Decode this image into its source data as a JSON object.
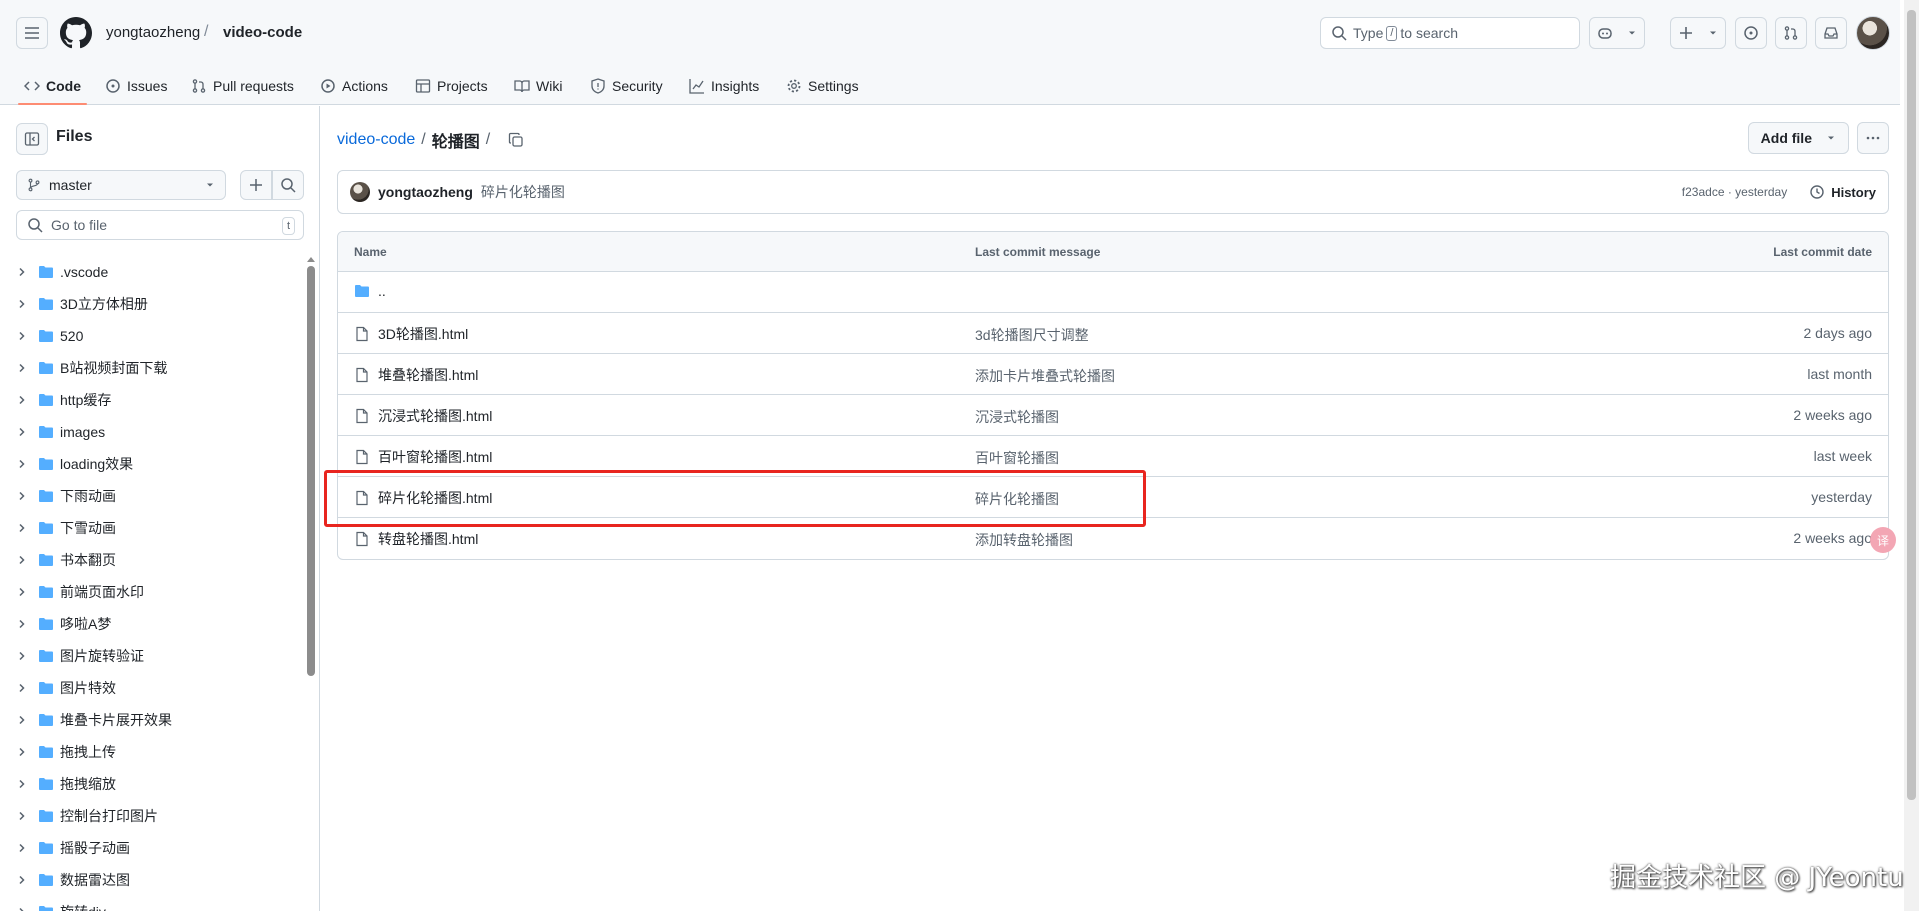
{
  "header": {
    "owner": "yongtaozheng",
    "separator": "/",
    "repo": "video-code",
    "search_prefix": "Type",
    "search_key": "/",
    "search_suffix": "to search"
  },
  "nav": [
    {
      "label": "Code",
      "icon": "code-icon",
      "active": true
    },
    {
      "label": "Issues",
      "icon": "issue-icon"
    },
    {
      "label": "Pull requests",
      "icon": "pull-request-icon"
    },
    {
      "label": "Actions",
      "icon": "play-icon"
    },
    {
      "label": "Projects",
      "icon": "table-icon"
    },
    {
      "label": "Wiki",
      "icon": "book-icon"
    },
    {
      "label": "Security",
      "icon": "shield-icon"
    },
    {
      "label": "Insights",
      "icon": "graph-icon"
    },
    {
      "label": "Settings",
      "icon": "gear-icon"
    }
  ],
  "sidebar": {
    "title": "Files",
    "branch": "master",
    "goto_placeholder": "Go to file",
    "goto_key": "t",
    "items": [
      ".vscode",
      "3D立方体相册",
      "520",
      "B站视频封面下载",
      "http缓存",
      "images",
      "loading效果",
      "下雨动画",
      "下雪动画",
      "书本翻页",
      "前端页面水印",
      "哆啦A梦",
      "图片旋转验证",
      "图片特效",
      "堆叠卡片展开效果",
      "拖拽上传",
      "拖拽缩放",
      "控制台打印图片",
      "摇骰子动画",
      "数据雷达图",
      "旋转div"
    ]
  },
  "main": {
    "path_repo": "video-code",
    "path_sep": "/",
    "path_folder": "轮播图",
    "path_trail": "/",
    "add_file": "Add file",
    "commit": {
      "author": "yongtaozheng",
      "message": "碎片化轮播图",
      "meta": "f23adce · yesterday",
      "history": "History"
    },
    "table": {
      "headers": [
        "Name",
        "Last commit message",
        "Last commit date"
      ],
      "parent": "..",
      "rows": [
        {
          "name": "3D轮播图.html",
          "msg": "3d轮播图尺寸调整",
          "date": "2 days ago"
        },
        {
          "name": "堆叠轮播图.html",
          "msg": "添加卡片堆叠式轮播图",
          "date": "last month"
        },
        {
          "name": "沉浸式轮播图.html",
          "msg": "沉浸式轮播图",
          "date": "2 weeks ago"
        },
        {
          "name": "百叶窗轮播图.html",
          "msg": "百叶窗轮播图",
          "date": "last week"
        },
        {
          "name": "碎片化轮播图.html",
          "msg": "碎片化轮播图",
          "date": "yesterday"
        },
        {
          "name": "转盘轮播图.html",
          "msg": "添加转盘轮播图",
          "date": "2 weeks ago"
        }
      ]
    }
  },
  "overlay": {
    "watermark": "掘金技术社区 @ JYeontu",
    "float_button": "译"
  },
  "colors": {
    "accent_underline": "#fd8c73",
    "link": "#0969da",
    "folder": "#54aeff",
    "highlight": "#e8251f"
  }
}
